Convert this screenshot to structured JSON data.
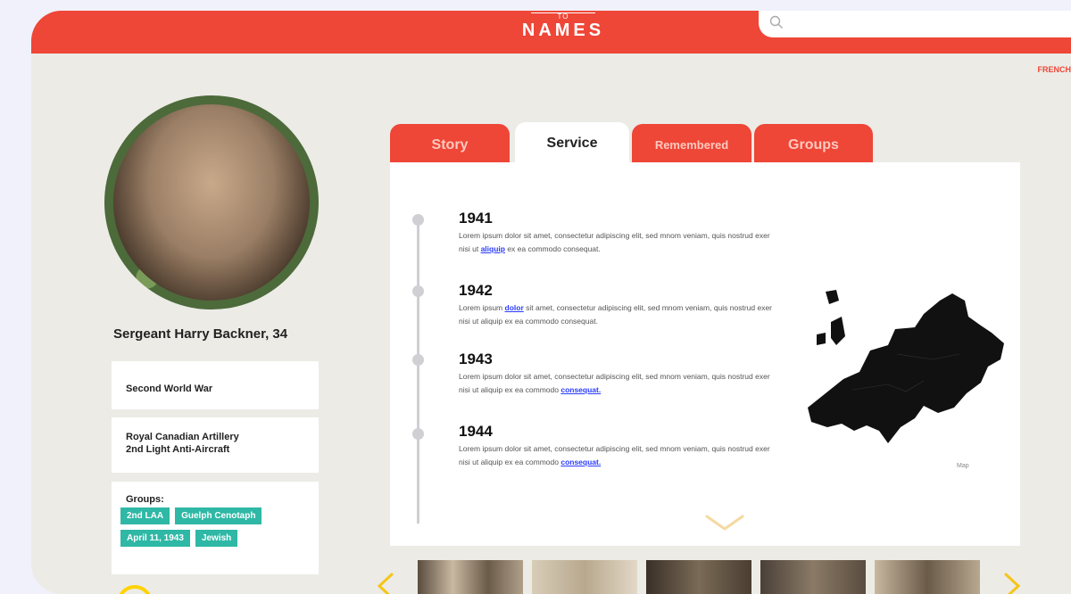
{
  "header": {
    "logo_small": "TO",
    "logo_main": "NAMES",
    "search_placeholder": "",
    "lang_label": "FRENCH"
  },
  "profile": {
    "name": "Sergeant Harry Backner, 34",
    "war": "Second World War",
    "unit_line1": "Royal Canadian Artillery",
    "unit_line2": "2nd Light Anti-Aircraft",
    "groups_label": "Groups:",
    "groups": [
      "2nd LAA",
      "Guelph Cenotaph",
      "April 11, 1943",
      "Jewish"
    ]
  },
  "tabs": [
    "Story",
    "Service",
    "Remembered",
    "Groups"
  ],
  "active_tab": "Service",
  "timeline": [
    {
      "year": "1941",
      "text_before": "Lorem ipsum dolor sit amet, consectetur adipiscing elit, sed mnom veniam, quis nostrud exer nisi ut ",
      "link": "aliquip",
      "text_after": " ex ea commodo consequat."
    },
    {
      "year": "1942",
      "text_before": "Lorem ipsum ",
      "link": "dolor",
      "text_after": " sit amet, consectetur adipiscing elit, sed mnom veniam, quis nostrud exer nisi ut aliquip ex ea commodo consequat."
    },
    {
      "year": "1943",
      "text_before": "Lorem ipsum dolor sit amet, consectetur adipiscing elit, sed mnom veniam, quis nostrud exer nisi ut aliquip ex ea commodo ",
      "link": "consequat.",
      "text_after": ""
    },
    {
      "year": "1944",
      "text_before": "Lorem ipsum dolor sit amet, consectetur adipiscing elit, sed mnom veniam, quis nostrud exer nisi ut aliquip ex ea commodo ",
      "link": "consequat.",
      "text_after": ""
    }
  ],
  "map": {
    "caption": "Map"
  },
  "colors": {
    "brand_red": "#ee4637",
    "tag_teal": "#2eb8a5",
    "link_blue": "#2a3cff",
    "accent_yellow": "#ffd200"
  },
  "icons": [
    "search-icon",
    "chevron-down-icon",
    "chevron-left-icon",
    "chevron-right-icon"
  ]
}
